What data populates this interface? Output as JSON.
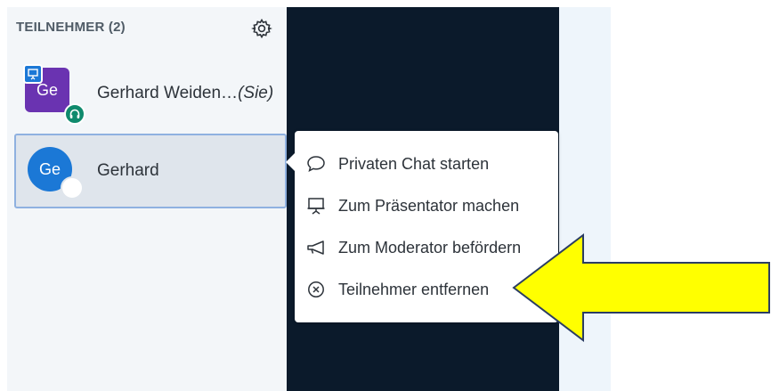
{
  "participants": {
    "header": "TEILNEHMER (2)",
    "users": [
      {
        "initials": "Ge",
        "name": "Gerhard Weiden…",
        "suffix": "(Sie)",
        "avatar_color": "#6a33b1"
      },
      {
        "initials": "Ge",
        "name": "Gerhard",
        "avatar_color": "#1b78d6"
      }
    ]
  },
  "context_menu": {
    "items": [
      {
        "label": "Privaten Chat starten",
        "icon": "chat-bubble-icon"
      },
      {
        "label": "Zum Präsentator machen",
        "icon": "presentation-board-icon"
      },
      {
        "label": "Zum Moderator befördern",
        "icon": "megaphone-icon"
      },
      {
        "label": "Teilnehmer entfernen",
        "icon": "circle-x-icon"
      }
    ]
  },
  "colors": {
    "presentation_area": "#0b1a2b",
    "sidebar_bg": "#f3f6f9",
    "highlight_arrow": "#ffff00",
    "selected_border": "#8fb1e0"
  }
}
